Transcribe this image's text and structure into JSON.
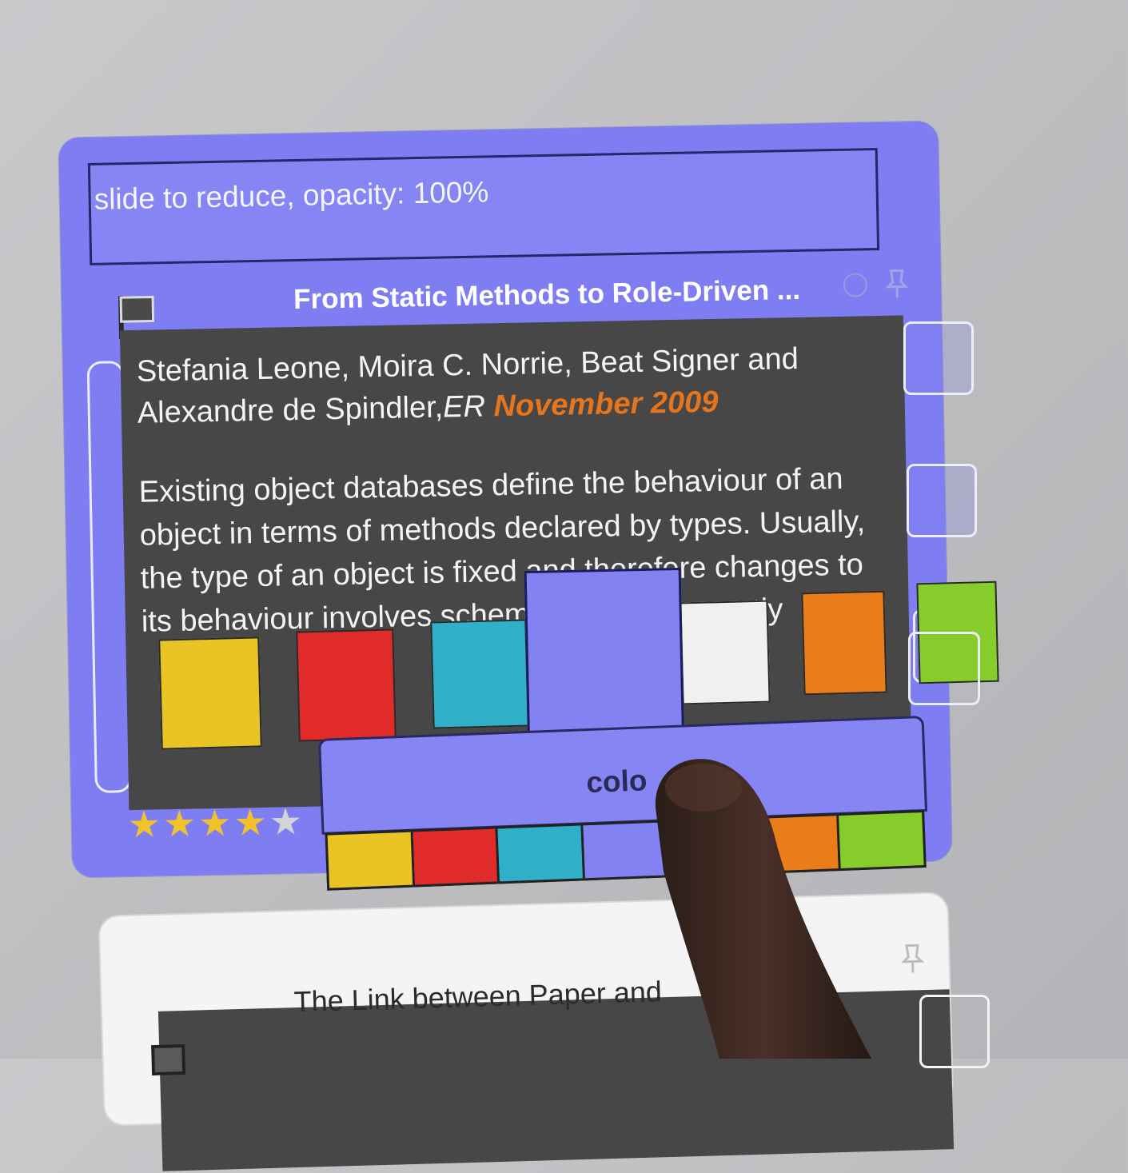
{
  "opacity_slider": {
    "label": "slide to reduce, opacity: 100%"
  },
  "card": {
    "title": "From  Static Methods to Role-Driven ...",
    "authors": "Stefania Leone, Moira C. Norrie, Beat Signer and Alexandre de Spindler,",
    "venue": "ER",
    "date": "November 2009",
    "abstract": "Existing object databases define the behaviour of an object in terms of methods declared by types. Usually, the type of an object is fixed and therefore changes to its behaviour involves schema c... consequently",
    "rating": {
      "value": 4,
      "max": 5
    },
    "icons": [
      "flag-icon",
      "circle-icon",
      "pin-icon",
      "star-icon"
    ]
  },
  "color_menu": {
    "label": "colo",
    "colors": [
      "#e8c425",
      "#e12a2a",
      "#2fb0c8",
      "#8282f2",
      "#f0f0ee",
      "#ea7d1a",
      "#86cc2a"
    ]
  },
  "floating_swatches": [
    "#e8c425",
    "#e12a2a",
    "#2fb0c8",
    "#8282f2",
    "#f0f0ee",
    "#ea7d1a",
    "#86cc2a"
  ],
  "second_card": {
    "title": "The Link between Paper and"
  }
}
